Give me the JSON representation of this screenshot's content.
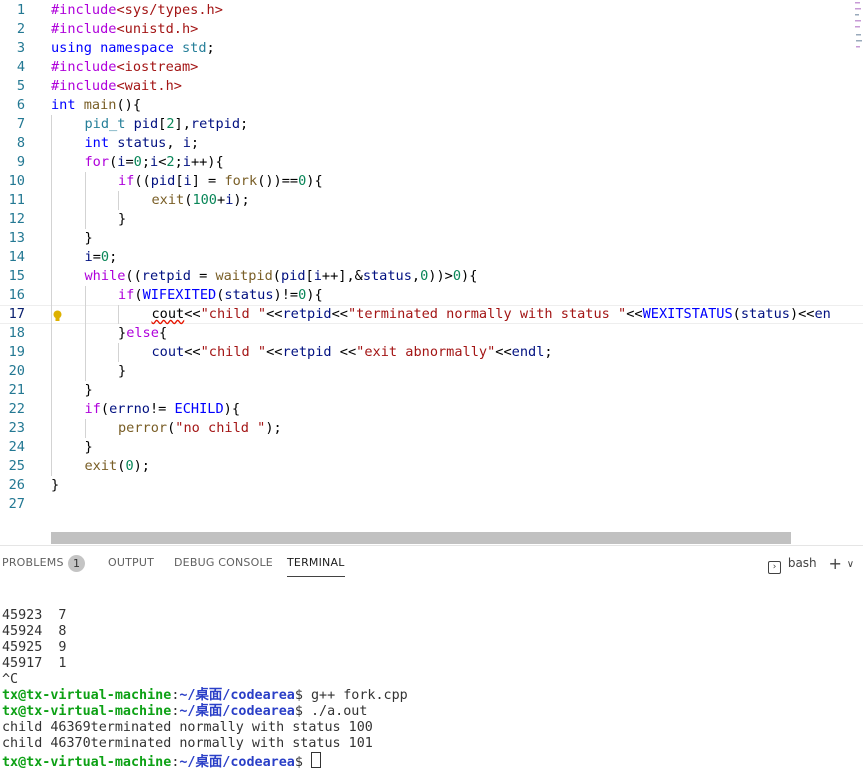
{
  "editor": {
    "lines": [
      {
        "n": "1",
        "indent": 0,
        "tokens": [
          [
            "pp",
            "#include"
          ],
          [
            "inc",
            "<sys/types.h>"
          ]
        ]
      },
      {
        "n": "2",
        "indent": 0,
        "tokens": [
          [
            "pp",
            "#include"
          ],
          [
            "inc",
            "<unistd.h>"
          ]
        ]
      },
      {
        "n": "3",
        "indent": 0,
        "tokens": [
          [
            "kw",
            "using"
          ],
          [
            "txt",
            " "
          ],
          [
            "kw",
            "namespace"
          ],
          [
            "txt",
            " "
          ],
          [
            "ty",
            "std"
          ],
          [
            "txt",
            ";"
          ]
        ]
      },
      {
        "n": "4",
        "indent": 0,
        "tokens": [
          [
            "pp",
            "#include"
          ],
          [
            "inc",
            "<iostream>"
          ]
        ]
      },
      {
        "n": "5",
        "indent": 0,
        "tokens": [
          [
            "pp",
            "#include"
          ],
          [
            "inc",
            "<wait.h>"
          ]
        ]
      },
      {
        "n": "6",
        "indent": 0,
        "tokens": [
          [
            "kw",
            "int"
          ],
          [
            "txt",
            " "
          ],
          [
            "fn",
            "main"
          ],
          [
            "txt",
            "(){"
          ]
        ]
      },
      {
        "n": "7",
        "indent": 1,
        "tokens": [
          [
            "ty",
            "pid_t"
          ],
          [
            "txt",
            " "
          ],
          [
            "var",
            "pid"
          ],
          [
            "txt",
            "["
          ],
          [
            "num",
            "2"
          ],
          [
            "txt",
            "],"
          ],
          [
            "var",
            "retpid"
          ],
          [
            "txt",
            ";"
          ]
        ]
      },
      {
        "n": "8",
        "indent": 1,
        "tokens": [
          [
            "kw",
            "int"
          ],
          [
            "txt",
            " "
          ],
          [
            "var",
            "status"
          ],
          [
            "txt",
            ", "
          ],
          [
            "var",
            "i"
          ],
          [
            "txt",
            ";"
          ]
        ]
      },
      {
        "n": "9",
        "indent": 1,
        "tokens": [
          [
            "ctrl",
            "for"
          ],
          [
            "txt",
            "("
          ],
          [
            "var",
            "i"
          ],
          [
            "txt",
            "="
          ],
          [
            "num",
            "0"
          ],
          [
            "txt",
            ";"
          ],
          [
            "var",
            "i"
          ],
          [
            "txt",
            "<"
          ],
          [
            "num",
            "2"
          ],
          [
            "txt",
            ";"
          ],
          [
            "var",
            "i"
          ],
          [
            "txt",
            "++){"
          ]
        ]
      },
      {
        "n": "10",
        "indent": 2,
        "tokens": [
          [
            "ctrl",
            "if"
          ],
          [
            "txt",
            "(("
          ],
          [
            "var",
            "pid"
          ],
          [
            "txt",
            "["
          ],
          [
            "var",
            "i"
          ],
          [
            "txt",
            "] = "
          ],
          [
            "fn",
            "fork"
          ],
          [
            "txt",
            "())=="
          ],
          [
            "num",
            "0"
          ],
          [
            "txt",
            "){"
          ]
        ]
      },
      {
        "n": "11",
        "indent": 3,
        "tokens": [
          [
            "fn",
            "exit"
          ],
          [
            "txt",
            "("
          ],
          [
            "num",
            "100"
          ],
          [
            "txt",
            "+"
          ],
          [
            "var",
            "i"
          ],
          [
            "txt",
            ");"
          ]
        ]
      },
      {
        "n": "12",
        "indent": 2,
        "tokens": [
          [
            "txt",
            "}"
          ]
        ]
      },
      {
        "n": "13",
        "indent": 1,
        "tokens": [
          [
            "txt",
            "}"
          ]
        ]
      },
      {
        "n": "14",
        "indent": 1,
        "tokens": [
          [
            "var",
            "i"
          ],
          [
            "txt",
            "="
          ],
          [
            "num",
            "0"
          ],
          [
            "txt",
            ";"
          ]
        ]
      },
      {
        "n": "15",
        "indent": 1,
        "tokens": [
          [
            "ctrl",
            "while"
          ],
          [
            "txt",
            "(("
          ],
          [
            "var",
            "retpid"
          ],
          [
            "txt",
            " = "
          ],
          [
            "fn",
            "waitpid"
          ],
          [
            "txt",
            "("
          ],
          [
            "var",
            "pid"
          ],
          [
            "txt",
            "["
          ],
          [
            "var",
            "i"
          ],
          [
            "txt",
            "++],&"
          ],
          [
            "var",
            "status"
          ],
          [
            "txt",
            ","
          ],
          [
            "num",
            "0"
          ],
          [
            "txt",
            "))>"
          ],
          [
            "num",
            "0"
          ],
          [
            "txt",
            "){"
          ]
        ]
      },
      {
        "n": "16",
        "indent": 2,
        "tokens": [
          [
            "ctrl",
            "if"
          ],
          [
            "txt",
            "("
          ],
          [
            "mac",
            "WIFEXITED"
          ],
          [
            "txt",
            "("
          ],
          [
            "var",
            "status"
          ],
          [
            "txt",
            ")!="
          ],
          [
            "num",
            "0"
          ],
          [
            "txt",
            "){"
          ]
        ]
      },
      {
        "n": "17",
        "indent": 3,
        "current": true,
        "tokens": [
          [
            "squig",
            "cout"
          ],
          [
            "txt",
            "<<"
          ],
          [
            "str",
            "\"child \""
          ],
          [
            "txt",
            "<<"
          ],
          [
            "var",
            "retpid"
          ],
          [
            "txt",
            "<<"
          ],
          [
            "str",
            "\"terminated normally with status \""
          ],
          [
            "txt",
            "<<"
          ],
          [
            "mac",
            "WEXITSTATUS"
          ],
          [
            "txt",
            "("
          ],
          [
            "var",
            "status"
          ],
          [
            "txt",
            ")<<"
          ],
          [
            "var",
            "en"
          ]
        ]
      },
      {
        "n": "18",
        "indent": 2,
        "tokens": [
          [
            "txt",
            "}"
          ],
          [
            "ctrl",
            "else"
          ],
          [
            "txt",
            "{"
          ]
        ]
      },
      {
        "n": "19",
        "indent": 3,
        "tokens": [
          [
            "var",
            "cout"
          ],
          [
            "txt",
            "<<"
          ],
          [
            "str",
            "\"child \""
          ],
          [
            "txt",
            "<<"
          ],
          [
            "var",
            "retpid"
          ],
          [
            "txt",
            " <<"
          ],
          [
            "str",
            "\"exit abnormally\""
          ],
          [
            "txt",
            "<<"
          ],
          [
            "var",
            "endl"
          ],
          [
            "txt",
            ";"
          ]
        ]
      },
      {
        "n": "20",
        "indent": 2,
        "tokens": [
          [
            "txt",
            "}"
          ]
        ]
      },
      {
        "n": "21",
        "indent": 1,
        "tokens": [
          [
            "txt",
            "}"
          ]
        ]
      },
      {
        "n": "22",
        "indent": 1,
        "tokens": [
          [
            "ctrl",
            "if"
          ],
          [
            "txt",
            "("
          ],
          [
            "var",
            "errno"
          ],
          [
            "txt",
            "!= "
          ],
          [
            "mac",
            "ECHILD"
          ],
          [
            "txt",
            "){"
          ]
        ]
      },
      {
        "n": "23",
        "indent": 2,
        "tokens": [
          [
            "fn",
            "perror"
          ],
          [
            "txt",
            "("
          ],
          [
            "str",
            "\"no child \""
          ],
          [
            "txt",
            ");"
          ]
        ]
      },
      {
        "n": "24",
        "indent": 1,
        "tokens": [
          [
            "txt",
            "}"
          ]
        ]
      },
      {
        "n": "25",
        "indent": 1,
        "tokens": [
          [
            "fn",
            "exit"
          ],
          [
            "txt",
            "("
          ],
          [
            "num",
            "0"
          ],
          [
            "txt",
            ");"
          ]
        ]
      },
      {
        "n": "26",
        "indent": 0,
        "tokens": [
          [
            "txt",
            "}"
          ]
        ]
      },
      {
        "n": "27",
        "indent": 0,
        "tokens": []
      }
    ]
  },
  "panel": {
    "tabs": {
      "problems": "PROBLEMS",
      "problems_count": "1",
      "output": "OUTPUT",
      "debug_console": "DEBUG CONSOLE",
      "terminal": "TERMINAL"
    },
    "shell_label": "bash",
    "add_label": "+",
    "chevron_label": "∨"
  },
  "terminal": {
    "lines": [
      {
        "type": "plain",
        "text": ""
      },
      {
        "type": "plain",
        "text": "45923  7"
      },
      {
        "type": "plain",
        "text": "45924  8"
      },
      {
        "type": "plain",
        "text": "45925  9"
      },
      {
        "type": "plain",
        "text": "45917  1"
      },
      {
        "type": "plain",
        "text": "^C"
      },
      {
        "type": "prompt",
        "user": "tx@tx-virtual-machine",
        "sep": ":",
        "path": "~/桌面/codearea",
        "sign": "$ ",
        "cmd": "g++ fork.cpp"
      },
      {
        "type": "prompt",
        "user": "tx@tx-virtual-machine",
        "sep": ":",
        "path": "~/桌面/codearea",
        "sign": "$ ",
        "cmd": "./a.out"
      },
      {
        "type": "plain",
        "text": "child 46369terminated normally with status 100"
      },
      {
        "type": "plain",
        "text": "child 46370terminated normally with status 101"
      },
      {
        "type": "prompt",
        "user": "tx@tx-virtual-machine",
        "sep": ":",
        "path": "~/桌面/codearea",
        "sign": "$ ",
        "cmd": "",
        "cursor": true
      }
    ]
  },
  "colors": {
    "line_number": "#237893",
    "terminal_user": "#0da115",
    "terminal_path": "#2a3fc7"
  }
}
